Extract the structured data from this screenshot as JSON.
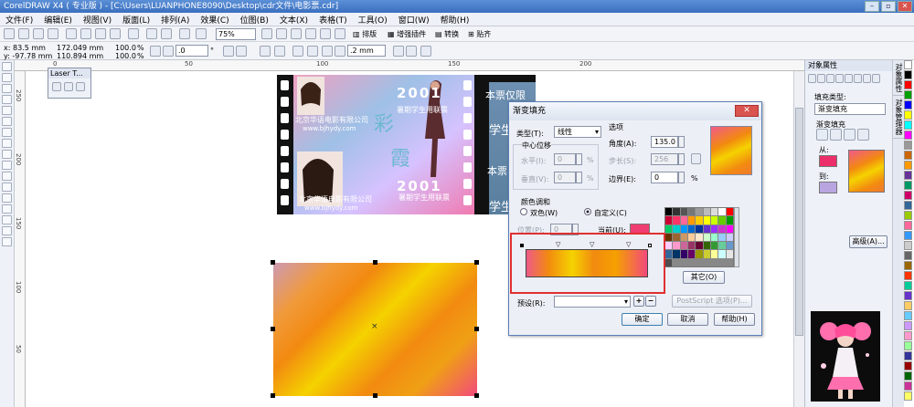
{
  "titlebar": {
    "title": "CorelDRAW X4 ( 专业版 ) - [C:\\Users\\LUANPHONE8090\\Desktop\\cdr文件\\电影票.cdr]",
    "min_icon": "minimize-icon",
    "max_icon": "maximize-icon",
    "close_icon": "close-icon"
  },
  "menu": [
    "文件(F)",
    "编辑(E)",
    "视图(V)",
    "版面(L)",
    "排列(A)",
    "效果(C)",
    "位图(B)",
    "文本(X)",
    "表格(T)",
    "工具(O)",
    "窗口(W)",
    "帮助(H)"
  ],
  "toolbar": {
    "zoom": "75%",
    "btn_layout": "排版",
    "btn_plugins": "增强插件",
    "btn_convert": "转换",
    "btn_stick": "贴齐"
  },
  "propbar": {
    "x": "x: 83.5 mm",
    "y": "y: -97.78 mm",
    "w": "172.049 mm",
    "h": "110.894 mm",
    "sx": "100.0",
    "sy": "100.0",
    "pct1": "%",
    "pct2": "%",
    "rotate": ".0",
    "rot_unit": "°",
    "outline": ".2 mm"
  },
  "rulers": {
    "top": [
      "0",
      "50",
      "100",
      "150",
      "200"
    ],
    "left": [
      "250",
      "200",
      "150",
      "100",
      "50"
    ]
  },
  "laser": {
    "title": "Laser T..."
  },
  "ticket": {
    "banner1": "本票仅限",
    "banner2": "学生",
    "banner3": "本票",
    "banner4": "学生",
    "company1": "北京华语电影有限公司",
    "url1": "www.bjhydy.com",
    "company2": "北京华语电影有限公司",
    "url2": "www.bjhydy.com",
    "big1": "彩",
    "big2": "霞",
    "year": "2001",
    "year2": "2001",
    "subtitle1": "暑期学生用联票",
    "subtitle2": "暑期学生用联票"
  },
  "dialog": {
    "title": "渐变填充",
    "close": "✕",
    "type_label": "类型(T):",
    "type_value": "线性",
    "options_label": "选项",
    "center_label": "中心位移",
    "h_label": "水平(I):",
    "h_value": "0",
    "v_label": "垂直(V):",
    "v_value": "0",
    "pct": "%",
    "angle_label": "角度(A):",
    "angle_value": "135.0",
    "steps_label": "步长(S):",
    "steps_value": "256",
    "edge_label": "边界(E):",
    "edge_value": "0",
    "edge_unit": "%",
    "blend_label": "颜色调和",
    "two_color": "双色(W)",
    "custom": "自定义(C)",
    "position_label": "位置(P):",
    "position_value": "0",
    "current_label": "当前(U):",
    "other_btn": "其它(O)",
    "preset_label": "预设(R):",
    "postscript_btn": "PostScript 选项(P)...",
    "ok": "确定",
    "cancel": "取消",
    "help": "帮助(H)",
    "current_color": "#f03e70"
  },
  "palette": [
    "#000000",
    "#333333",
    "#555555",
    "#777777",
    "#999999",
    "#bbbbbb",
    "#dddddd",
    "#ffffff",
    "#ff0000",
    "#cc0033",
    "#ff3366",
    "#ff6699",
    "#ff9900",
    "#ffcc00",
    "#ffff00",
    "#ccff00",
    "#66cc00",
    "#009900",
    "#00cc66",
    "#00cccc",
    "#0099ff",
    "#0066cc",
    "#003399",
    "#6633cc",
    "#9933ff",
    "#cc33cc",
    "#ff00ff",
    "#663300",
    "#996633",
    "#cc9966",
    "#ffcc99",
    "#ffe6cc",
    "#ccffcc",
    "#99ffcc",
    "#99ccff",
    "#ccccff",
    "#ffccff",
    "#ff99cc",
    "#cc6699",
    "#993366",
    "#660033",
    "#336600",
    "#339933",
    "#66cc99",
    "#6699cc",
    "#336699",
    "#003366",
    "#330066",
    "#660066",
    "#999900",
    "#cccc33",
    "#ffff99",
    "#ccffff",
    "#e6e6e6",
    "#4d4d4d"
  ],
  "panel": {
    "header": "对象属性",
    "fill_type_label": "填充类型:",
    "fill_type_value": "渐变填充",
    "grad_label": "渐变填充",
    "from_label": "从:",
    "to_label": "到:",
    "advanced": "高级(A)...",
    "from_color": "#ec2e6a",
    "to_color": "#b9a6e0"
  },
  "palstrip": [
    "#ffffff",
    "#000000",
    "#ff0000",
    "#00a000",
    "#0000ff",
    "#ffff00",
    "#00ffff",
    "#ff00ff",
    "#999999",
    "#cc6600",
    "#ff9900",
    "#663399",
    "#009966",
    "#cc0066",
    "#336699",
    "#99cc00",
    "#ff6699",
    "#3399ff",
    "#cccccc",
    "#666666",
    "#996600",
    "#ff3300",
    "#00cc99",
    "#6633cc",
    "#ffcc66",
    "#66ccff",
    "#cc99ff",
    "#ff99cc",
    "#99ff99",
    "#333399",
    "#990000",
    "#006600",
    "#cc3399",
    "#ffff66"
  ],
  "sidetabs": [
    "对象属性",
    "对象管理器"
  ]
}
